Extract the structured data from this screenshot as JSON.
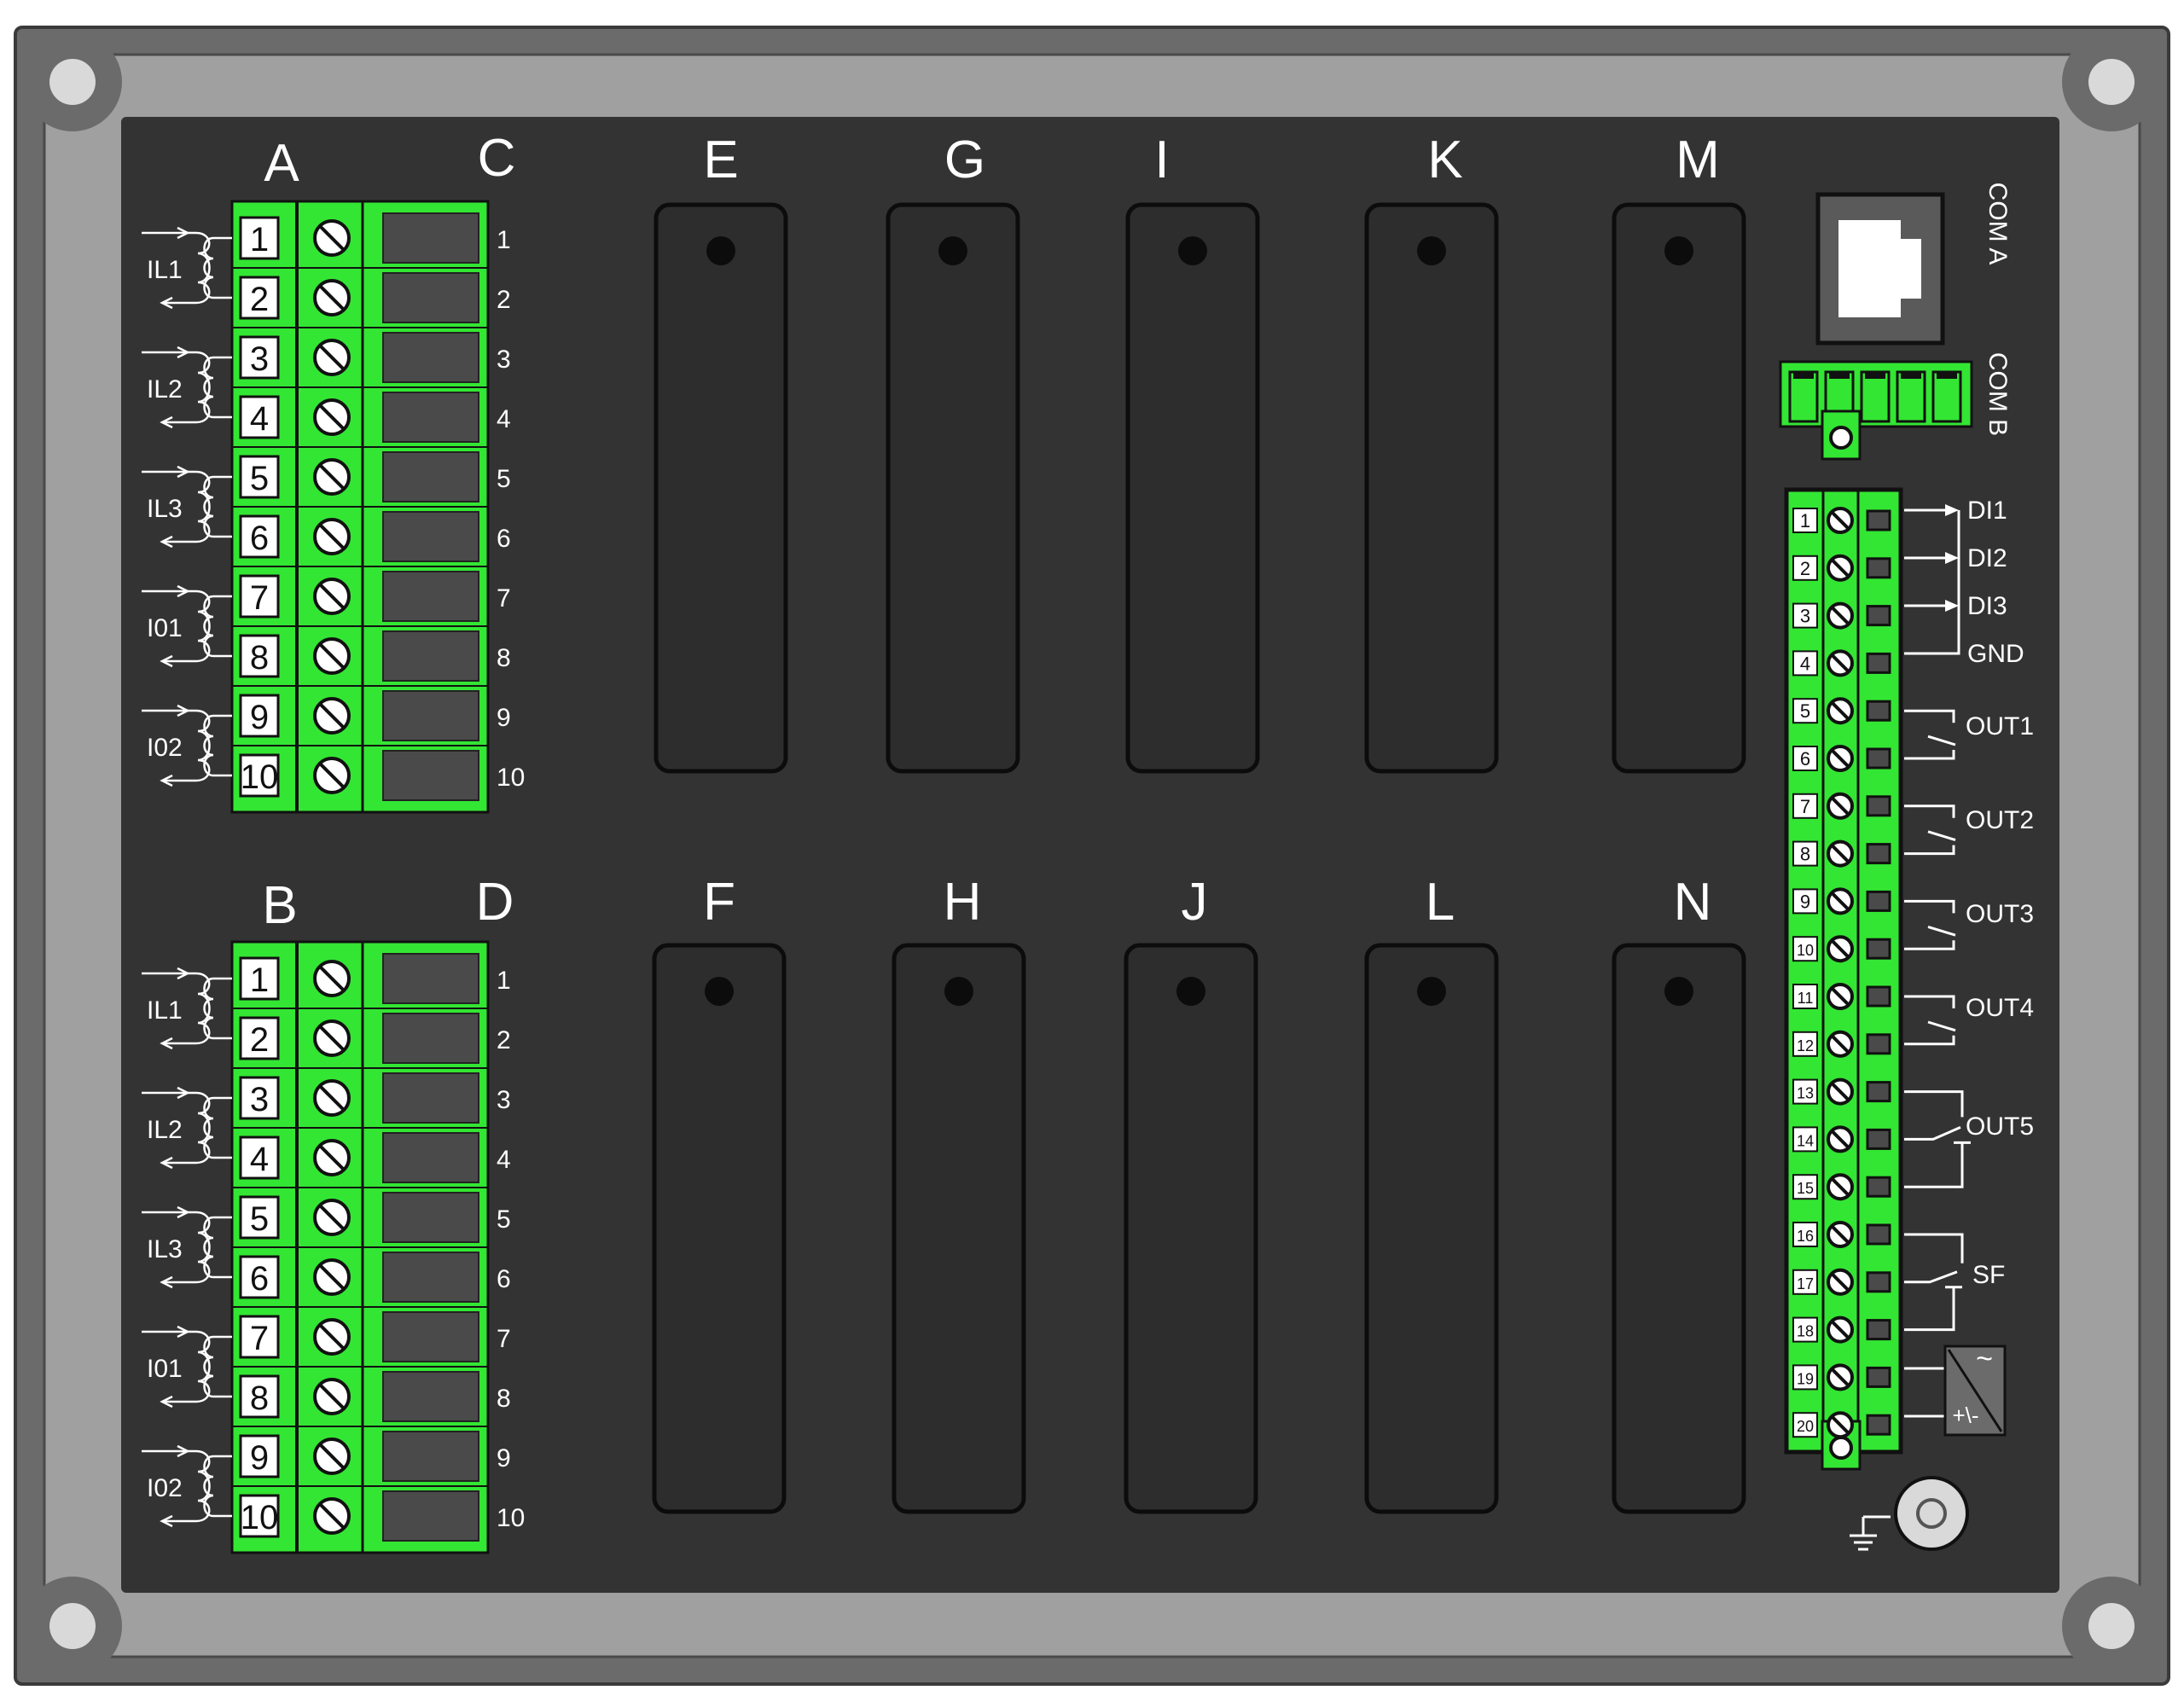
{
  "top_block": {
    "letter_left": "A",
    "letter_right": "C",
    "terminals": [
      "1",
      "2",
      "3",
      "4",
      "5",
      "6",
      "7",
      "8",
      "9",
      "10"
    ],
    "ct_labels": [
      "IL1",
      "IL2",
      "IL3",
      "I01",
      "I02"
    ]
  },
  "bottom_block": {
    "letter_left": "B",
    "letter_right": "D",
    "terminals": [
      "1",
      "2",
      "3",
      "4",
      "5",
      "6",
      "7",
      "8",
      "9",
      "10"
    ],
    "ct_labels": [
      "IL1",
      "IL2",
      "IL3",
      "I01",
      "I02"
    ]
  },
  "slots_top": [
    "E",
    "G",
    "I",
    "K",
    "M"
  ],
  "slots_bottom": [
    "F",
    "H",
    "J",
    "L",
    "N"
  ],
  "com_a_label": "COM A",
  "com_b_label": "COM B",
  "io_terminals": [
    "1",
    "2",
    "3",
    "4",
    "5",
    "6",
    "7",
    "8",
    "9",
    "10",
    "11",
    "12",
    "13",
    "14",
    "15",
    "16",
    "17",
    "18",
    "19",
    "20"
  ],
  "io_labels": {
    "di1": "DI1",
    "di2": "DI2",
    "di3": "DI3",
    "gnd": "GND",
    "out1": "OUT1",
    "out2": "OUT2",
    "out3": "OUT3",
    "out4": "OUT4",
    "out5": "OUT5",
    "sf": "SF"
  },
  "power_symbols": {
    "ac": "~",
    "dc": "+\\-"
  },
  "colors": {
    "terminal_green": "#33e633",
    "panel_dark": "#333333",
    "frame_grey": "#9b9b9b",
    "frame_outer": "#6b6b6b"
  }
}
